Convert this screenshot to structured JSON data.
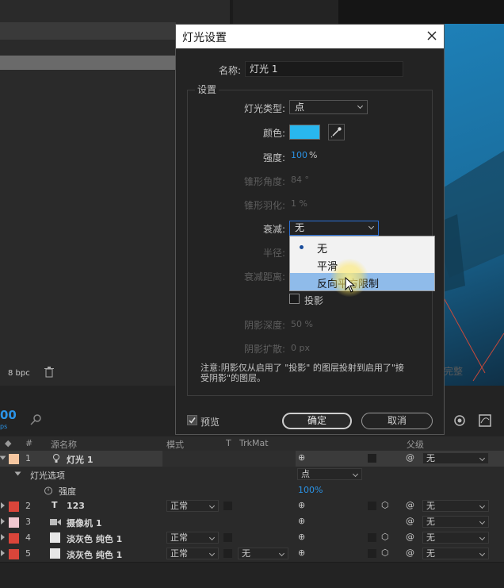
{
  "background": {
    "bpc": "8 bpc",
    "render_label": "完整",
    "time_display": "00",
    "time_sub": "ps"
  },
  "timeline": {
    "headers": {
      "source_name": "源名称",
      "mode": "模式",
      "t": "T",
      "trkmat": "TrkMat",
      "parent": "父级",
      "num": "#"
    },
    "layers": [
      {
        "num": "1",
        "name": "灯光 1",
        "color": "#f5c6a0",
        "mode": "",
        "parent": "无"
      },
      {
        "num": "2",
        "name": "123",
        "color": "#d9453a",
        "mode": "正常",
        "parent": "无"
      },
      {
        "num": "3",
        "name": "摄像机 1",
        "color": "#efc7cf",
        "mode": "",
        "parent": "无"
      },
      {
        "num": "4",
        "name": "淡灰色 纯色 1",
        "color": "#d9453a",
        "mode": "正常",
        "parent": "无"
      },
      {
        "num": "5",
        "name": "淡灰色 纯色 1",
        "color": "#d9453a",
        "mode": "正常",
        "trkmat": "无",
        "parent": "无"
      }
    ],
    "light_options": {
      "label": "灯光选项",
      "type_value": "点",
      "intensity_label": "强度",
      "intensity_value": "100%"
    },
    "switch_glyph": "⊕"
  },
  "dialog": {
    "title": "灯光设置",
    "name_label": "名称:",
    "name_value": "灯光 1",
    "settings_group": "设置",
    "light_type_label": "灯光类型:",
    "light_type_value": "点",
    "color_label": "颜色:",
    "color_value": "#29b7ee",
    "intensity_label": "强度:",
    "intensity_value": "100",
    "intensity_unit": "%",
    "cone_angle_label": "锥形角度:",
    "cone_angle_value": "84 °",
    "cone_feather_label": "锥形羽化:",
    "cone_feather_value": "1 %",
    "falloff_label": "衰减:",
    "falloff_value": "无",
    "falloff_options": [
      "无",
      "平滑",
      "反向平方限制"
    ],
    "radius_label": "半径:",
    "falloff_distance_label": "衰减距离:",
    "cast_shadows_label": "投影",
    "shadow_darkness_label": "阴影深度:",
    "shadow_darkness_value": "50 %",
    "shadow_diffusion_label": "阴影扩散:",
    "shadow_diffusion_value": "0 px",
    "note": "注意:阴影仅从启用了 \"投影\" 的图层投射到启用了\"接受阴影\"的图层。",
    "preview_label": "预览",
    "ok_label": "确定",
    "cancel_label": "取消"
  }
}
